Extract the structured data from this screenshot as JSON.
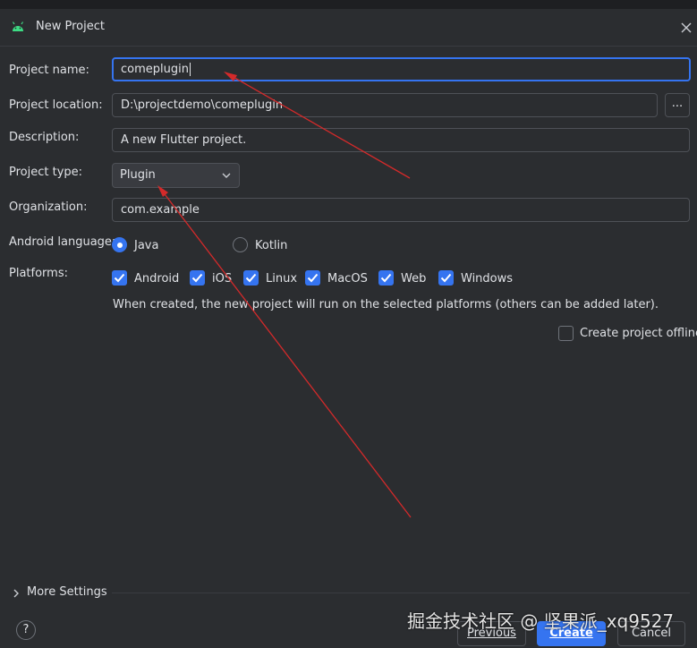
{
  "window": {
    "title": "New Project"
  },
  "form": {
    "project_name": {
      "label": "Project name:",
      "value": "comeplugin"
    },
    "project_location": {
      "label": "Project location:",
      "value": "D:\\projectdemo\\comeplugin",
      "browse_label": "..."
    },
    "description": {
      "label": "Description:",
      "value": "A new Flutter project."
    },
    "project_type": {
      "label": "Project type:",
      "selected": "Plugin"
    },
    "organization": {
      "label": "Organization:",
      "value": "com.example"
    },
    "android_language": {
      "label": "Android language:",
      "options": [
        {
          "label": "Java",
          "selected": true
        },
        {
          "label": "Kotlin",
          "selected": false
        }
      ]
    },
    "platforms": {
      "label": "Platforms:",
      "items": [
        {
          "label": "Android",
          "checked": true
        },
        {
          "label": "iOS",
          "checked": true
        },
        {
          "label": "Linux",
          "checked": true
        },
        {
          "label": "MacOS",
          "checked": true
        },
        {
          "label": "Web",
          "checked": true
        },
        {
          "label": "Windows",
          "checked": true
        }
      ],
      "info": "When created, the new project will run on the selected platforms (others can be added later)."
    },
    "offline": {
      "label": "Create project offline",
      "checked": false
    }
  },
  "more_settings": {
    "label": "More Settings"
  },
  "footer": {
    "help_label": "?",
    "previous_label": "Previous",
    "create_label": "Create",
    "cancel_label": "Cancel"
  },
  "watermark": "掘金技术社区 @ 坚果派_xq9527",
  "colors": {
    "accent": "#3574f0",
    "background": "#2b2d30",
    "annotation_arrow": "#d42a2a",
    "android_green": "#3ddc84"
  }
}
